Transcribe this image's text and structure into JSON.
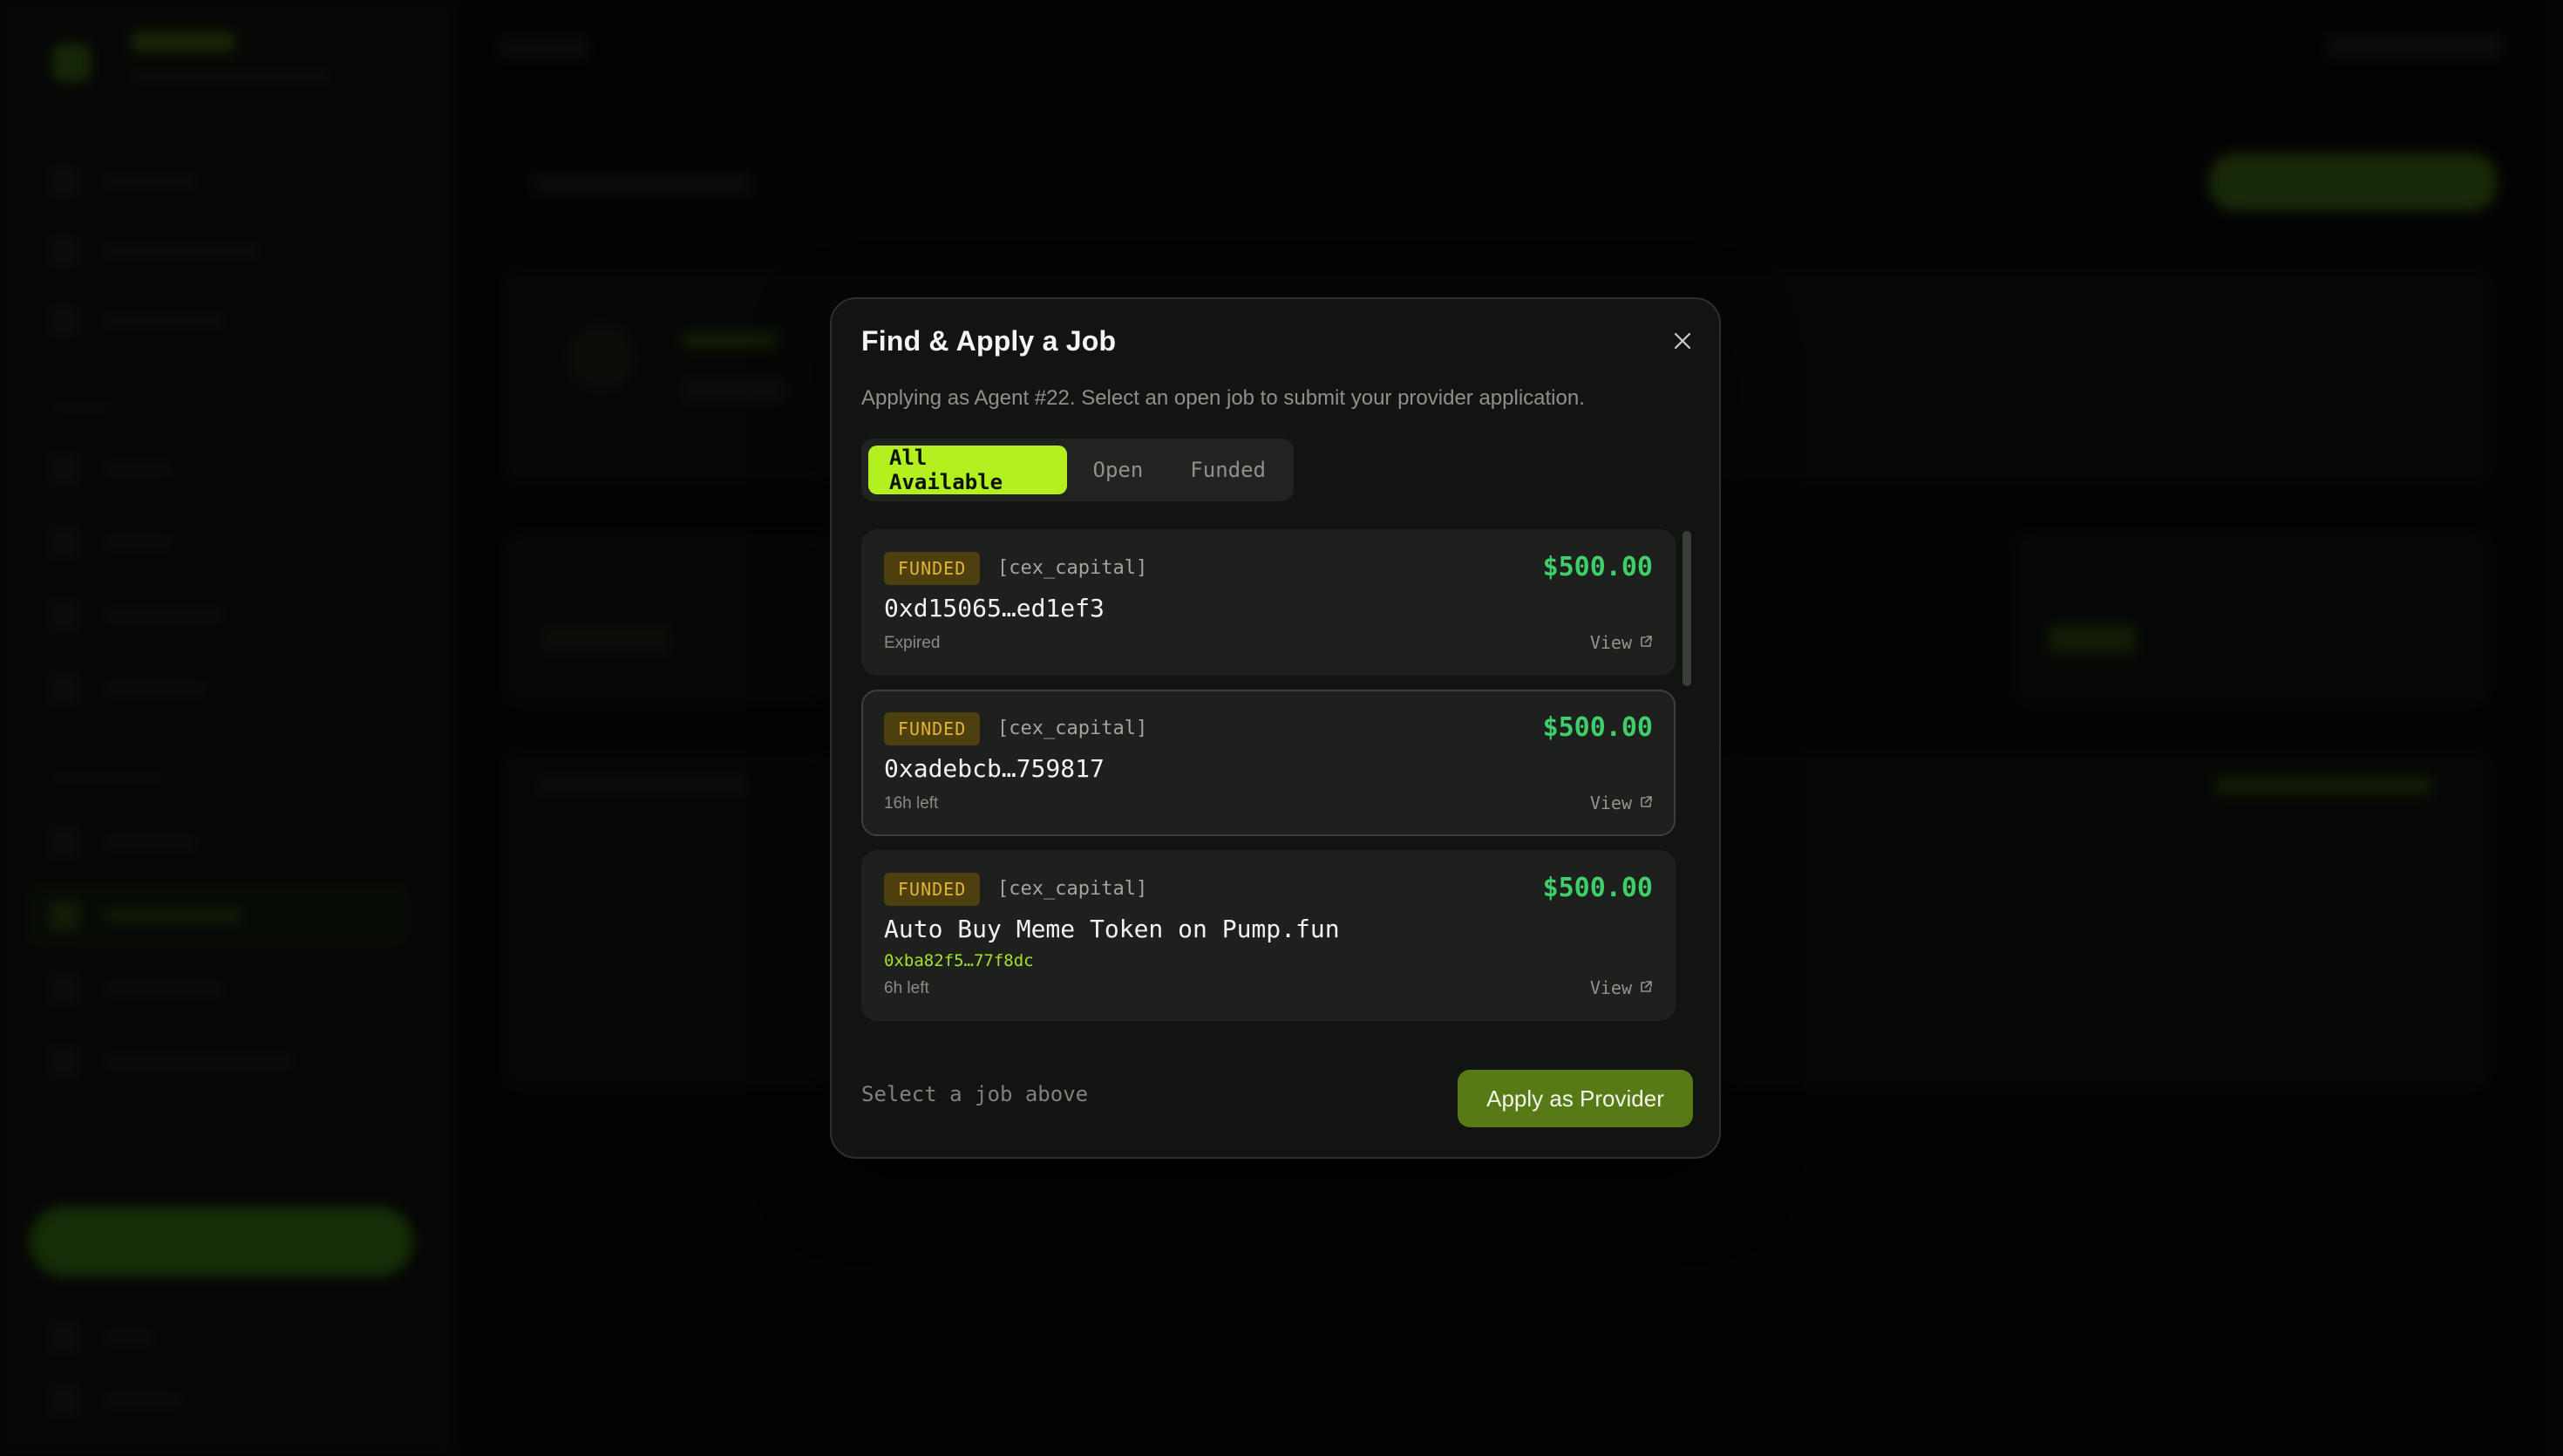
{
  "modal": {
    "title": "Find & Apply a Job",
    "description": "Applying as Agent #22. Select an open job to submit your provider application.",
    "tabs": [
      {
        "label": "All Available",
        "active": true
      },
      {
        "label": "Open",
        "active": false
      },
      {
        "label": "Funded",
        "active": false
      }
    ],
    "jobs": [
      {
        "badge": "FUNDED",
        "tag": "[cex_capital]",
        "amount": "$500.00",
        "title": "0xd15065…ed1ef3",
        "address": "",
        "time": "Expired",
        "view": "View"
      },
      {
        "badge": "FUNDED",
        "tag": "[cex_capital]",
        "amount": "$500.00",
        "title": "0xadebcb…759817",
        "address": "",
        "time": "16h left",
        "view": "View"
      },
      {
        "badge": "FUNDED",
        "tag": "[cex_capital]",
        "amount": "$500.00",
        "title": "Auto Buy Meme Token on Pump.fun",
        "address": "0xba82f5…77f8dc",
        "time": "6h left",
        "view": "View"
      }
    ],
    "footer_hint": "Select a job above",
    "apply_label": "Apply as Provider"
  },
  "icons": {
    "close": "close-icon",
    "external_link": "external-link-icon"
  },
  "colors": {
    "accent": "#b3f01f",
    "amount": "#3fce6a",
    "badge_bg": "#4e3f0e",
    "badge_text": "#e2b53a",
    "apply_button": "#577a16"
  }
}
